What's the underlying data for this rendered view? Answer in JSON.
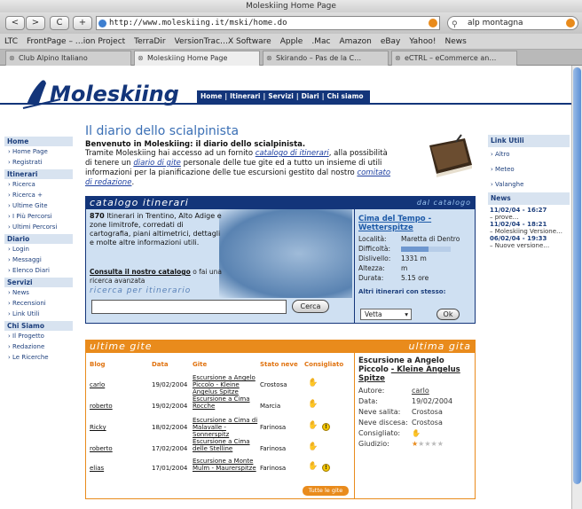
{
  "window": {
    "title": "Moleskiing Home Page"
  },
  "toolbar": {
    "back": "<",
    "forward": ">",
    "reload": "C",
    "add": "+",
    "url": "http://www.moleskiing.it/mski/home.do",
    "search": "alp montagna"
  },
  "bookmarks": [
    "LTC",
    "FrontPage – …ion Project",
    "TerraDir",
    "VersionTrac…X Software",
    "Apple",
    ".Mac",
    "Amazon",
    "eBay",
    "Yahoo!",
    "News"
  ],
  "tabs": [
    "Club Alpino Italiano",
    "Moleskiing Home Page",
    "Skirando – Pas de la C…",
    "eCTRL – eCommerce an…"
  ],
  "header": {
    "logo": "Moleskiing",
    "nav": [
      "Home",
      "Itinerari",
      "Servizi",
      "Diari",
      "Chi siamo"
    ]
  },
  "leftnav": [
    {
      "section": "Home",
      "items": [
        "Home Page",
        "Registrati"
      ]
    },
    {
      "section": "Itinerari",
      "items": [
        "Ricerca",
        "Ricerca +",
        "Ultime Gite",
        "I Più Percorsi",
        "Ultimi Percorsi"
      ]
    },
    {
      "section": "Diario",
      "items": [
        "Login",
        "Messaggi",
        "Elenco Diari"
      ]
    },
    {
      "section": "Servizi",
      "items": [
        "News",
        "Recensioni",
        "Link Utili"
      ]
    },
    {
      "section": "Chi Siamo",
      "items": [
        "Il Progetto",
        "Redazione",
        "Le Ricerche"
      ]
    }
  ],
  "rightnav": {
    "link_utili": {
      "title": "Link Utili",
      "items": [
        "Altro",
        "Meteo",
        "Valanghe"
      ]
    },
    "news": {
      "title": "News",
      "items": [
        {
          "date": "11/02/04 - 16:27",
          "text": "prove…"
        },
        {
          "date": "11/02/04 - 18:21",
          "text": "Moleskiing Versione…"
        },
        {
          "date": "06/02/04 - 19:33",
          "text": "Nuove versione…"
        }
      ]
    }
  },
  "main": {
    "title": "Il diario dello scialpinista",
    "intro_title": "Benvenuto in Moleskiing: il diario dello scialpinista.",
    "intro_1": "Tramite Moleskiing hai accesso ad un fornito",
    "intro_link1": "catalogo di itinerari",
    "intro_2": ", alla possibilità di tenere un",
    "intro_link2": "diario di gite",
    "intro_3": "personale delle tue gite ed a tutto un insieme di utili informazioni per la pianificazione delle tue escursioni gestito dal nostro",
    "intro_link3": "comitato di redazione",
    "intro_4": "."
  },
  "catalog": {
    "head": "catalogo itinerari",
    "head_right": "dal catalogo",
    "count": "870",
    "text": "Itinerari in Trentino, Alto Adige e zone limitrofe, corredati di cartografia, piani altimetrici, dettagli e molte altre informazioni utili.",
    "consult_link": "Consulta il nostro catalogo",
    "consult_rest": "o fai una ricerca avanzata",
    "ricerca_label": "ricerca per itinerario",
    "search_btn": "Cerca",
    "featured": {
      "title": "Cima del Tempo - Wetterspitze",
      "rows": [
        {
          "label": "Località:",
          "value": "Maretta di Dentro"
        },
        {
          "label": "Difficoltà:",
          "value": ""
        },
        {
          "label": "Dislivello:",
          "value": "1331 m"
        },
        {
          "label": "Altezza:",
          "value": "m"
        },
        {
          "label": "Durata:",
          "value": "5.15 ore"
        }
      ],
      "difficulty_level": 0.55,
      "altri_label": "Altri itinerari con stesso:",
      "select_value": "Vetta",
      "ok_btn": "Ok"
    }
  },
  "gite": {
    "head": "ultime gite",
    "head_right": "ultima gita",
    "columns": [
      "Blog",
      "Data",
      "Gite",
      "Stato neve",
      "Consigliato"
    ],
    "rows": [
      {
        "blog": "carlo",
        "date": "19/02/2004",
        "gita": "Escursione a Angelo Piccolo - Kleine Angelus Spitze",
        "neve": "Crostosa",
        "warn": false
      },
      {
        "blog": "roberto",
        "date": "19/02/2004",
        "gita": "Escursione a Cima Rocche",
        "neve": "Marcia",
        "warn": false
      },
      {
        "blog": "Ricky",
        "date": "18/02/2004",
        "gita": "Escursione a Cima di Malavalle - Sonnerspitz",
        "neve": "Farinosa",
        "warn": true
      },
      {
        "blog": "roberto",
        "date": "17/02/2004",
        "gita": "Escursione a Cima delle Stelline",
        "neve": "Farinosa",
        "warn": false
      },
      {
        "blog": "elias",
        "date": "17/01/2004",
        "gita": "Escursione a Monte Mulm - Maurerspitze",
        "neve": "Farinosa",
        "warn": true
      }
    ],
    "tutte": "Tutte le gite",
    "detail": {
      "title_1": "Escursione a Angelo Piccolo",
      "title_2": "- Kleine Angelus Spitze",
      "rows": [
        {
          "label": "Autore:",
          "value": "carlo"
        },
        {
          "label": "Data:",
          "value": "19/02/2004"
        },
        {
          "label": "Neve salita:",
          "value": "Crostosa"
        },
        {
          "label": "Neve discesa:",
          "value": "Crostosa"
        },
        {
          "label": "Consigliato:",
          "value": ""
        },
        {
          "label": "Giudizio:",
          "value": ""
        }
      ],
      "rating": 1,
      "rating_max": 5
    }
  }
}
